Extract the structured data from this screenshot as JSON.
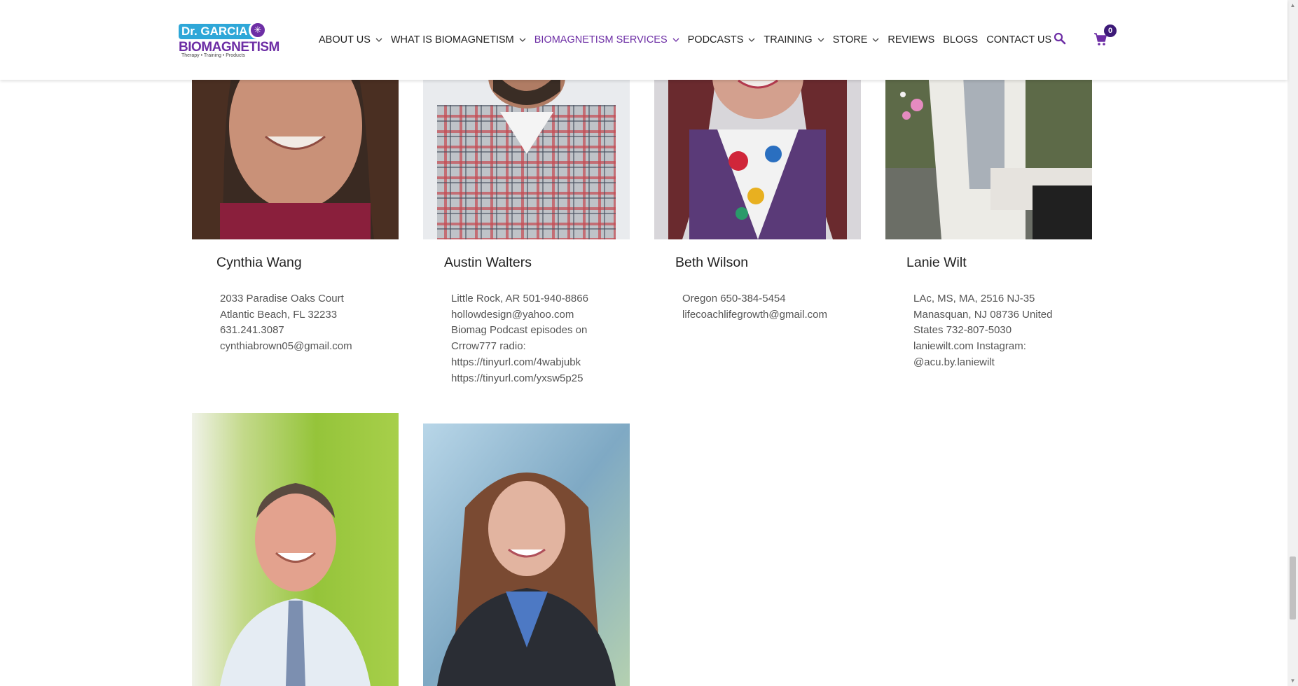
{
  "brand": {
    "logo_top": "Dr. GARCIA",
    "logo_main": "BIOMAGNETISM",
    "logo_tagline": "Therapy • Training • Products"
  },
  "nav": {
    "items": [
      {
        "label": "ABOUT US",
        "dropdown": true
      },
      {
        "label": "WHAT IS BIOMAGNETISM",
        "dropdown": true
      },
      {
        "label": "BIOMAGNETISM SERVICES",
        "dropdown": true,
        "active": true
      },
      {
        "label": "PODCASTS",
        "dropdown": true
      },
      {
        "label": "TRAINING",
        "dropdown": true
      },
      {
        "label": "STORE",
        "dropdown": true
      },
      {
        "label": "REVIEWS",
        "dropdown": false
      },
      {
        "label": "BLOGS",
        "dropdown": false
      },
      {
        "label": "CONTACT US",
        "dropdown": false
      }
    ],
    "cart_count": "0",
    "icons": {
      "search": "search-icon",
      "cart": "cart-icon"
    }
  },
  "colors": {
    "brand_purple": "#6d2ea5",
    "logo_blue": "#2ea7d8",
    "cart_badge": "#3d1a78"
  },
  "practitioners": [
    {
      "name": "Cynthia Wang",
      "lines": [
        "2033 Paradise Oaks Court",
        "Atlantic Beach, FL 32233",
        "631.241.3087",
        "cynthiabrown05@gmail.com"
      ]
    },
    {
      "name": "Austin Walters",
      "lines": [
        "Little Rock, AR 501-940-8866",
        "hollowdesign@yahoo.com",
        "Biomag Podcast episodes on",
        "Crrow777 radio:",
        "https://tinyurl.com/4wabjubk",
        "https://tinyurl.com/yxsw5p25"
      ]
    },
    {
      "name": "Beth Wilson",
      "lines": [
        "Oregon 650-384-5454",
        "lifecoachlifegrowth@gmail.com"
      ]
    },
    {
      "name": "Lanie Wilt",
      "lines": [
        "LAc, MS, MA, 2516 NJ-35",
        "Manasquan, NJ  08736 United",
        "States 732-807-5030",
        "laniewilt.com Instagram:",
        "@acu.by.laniewilt"
      ]
    }
  ]
}
